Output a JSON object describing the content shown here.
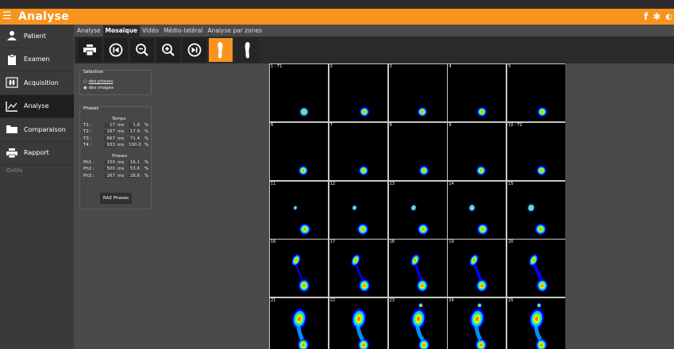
{
  "app": {
    "title": "Analyse",
    "header_icons": [
      "facebook-icon",
      "gear-icon"
    ]
  },
  "sidebar": {
    "items": [
      {
        "label": "Patient",
        "icon": "patient-icon"
      },
      {
        "label": "Examen",
        "icon": "clipboard-icon"
      },
      {
        "label": "Acquisition",
        "icon": "footprints-icon"
      },
      {
        "label": "Analyse",
        "icon": "chart-icon",
        "active": true
      },
      {
        "label": "Comparaison",
        "icon": "folder-icon"
      },
      {
        "label": "Rapport",
        "icon": "printer-icon"
      }
    ],
    "outils": "Outils"
  },
  "tabs": [
    {
      "label": "Analyse"
    },
    {
      "label": "Mosaïque",
      "active": true
    },
    {
      "label": "Vidéo"
    },
    {
      "label": "Médio-latéral"
    },
    {
      "label": "Analyse par zones"
    }
  ],
  "toolbar": [
    "print-icon",
    "skip-back-icon",
    "zoom-out-icon",
    "zoom-in-icon",
    "skip-forward-icon",
    "foot-left-icon",
    "foot-right-icon"
  ],
  "selection": {
    "title": "Sélection",
    "options": [
      {
        "label": "des phases",
        "checked": false
      },
      {
        "label": "des images",
        "checked": true
      }
    ]
  },
  "phases": {
    "title": "Phases",
    "temps_label": "Temps",
    "phases_label": "Phases",
    "temps": [
      {
        "name": "T1 :",
        "ms": "17",
        "unit": "ms",
        "pct": "1,8",
        "pct_unit": "%"
      },
      {
        "name": "T2 :",
        "ms": "167",
        "unit": "ms",
        "pct": "17,9",
        "pct_unit": "%"
      },
      {
        "name": "T3 :",
        "ms": "667",
        "unit": "ms",
        "pct": "71,4",
        "pct_unit": "%"
      },
      {
        "name": "T4 :",
        "ms": "933",
        "unit": "ms",
        "pct": "100,0",
        "pct_unit": "%"
      }
    ],
    "phase_rows": [
      {
        "name": "Ph1 :",
        "ms": "150",
        "unit": "ms",
        "pct": "16,1",
        "pct_unit": "%"
      },
      {
        "name": "Ph2 :",
        "ms": "500",
        "unit": "ms",
        "pct": "53,6",
        "pct_unit": "%"
      },
      {
        "name": "Ph3 :",
        "ms": "267",
        "unit": "ms",
        "pct": "28,6",
        "pct_unit": "%"
      }
    ],
    "raz_label": "RAZ Phases"
  },
  "mosaic": {
    "frames": [
      "1 - T1",
      "2",
      "3",
      "4",
      "5",
      "6",
      "7",
      "8",
      "9",
      "10 - T2",
      "11",
      "12",
      "13",
      "14",
      "15",
      "16",
      "17",
      "18",
      "19",
      "20",
      "21",
      "22",
      "23",
      "24",
      "25"
    ]
  }
}
